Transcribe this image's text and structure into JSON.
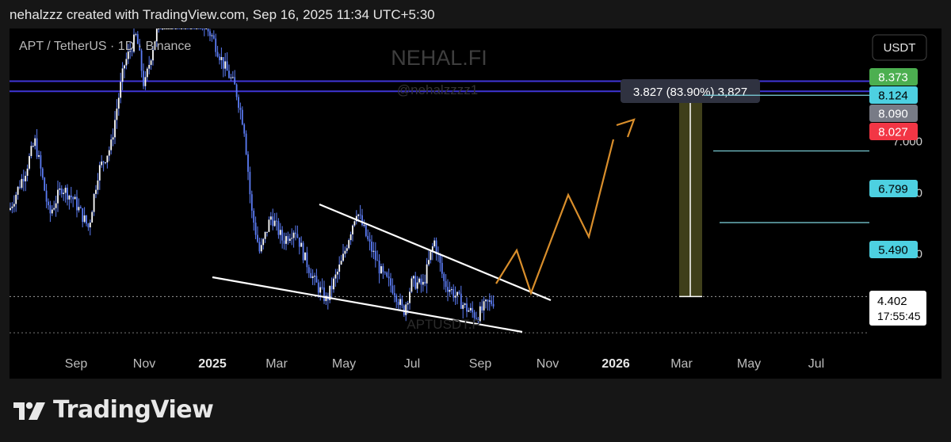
{
  "header": {
    "text": "nehalzzz created with TradingView.com, Sep 16, 2025 11:34 UTC+5:30"
  },
  "footer": {
    "brand": "TradingView"
  },
  "chart_data": {
    "type": "candlestick",
    "title": "APT / TetherUS · 1D · Binance",
    "watermark_name": "NEHAL.FI",
    "watermark_handle": "@nehalzzzz1",
    "watermark_symbol": "APTUSDT.P",
    "currency": "USDT",
    "y_scale": "log",
    "ylim": [
      3.85,
      9.8
    ],
    "x_ticks": [
      "Sep",
      "Nov",
      "2025",
      "Mar",
      "May",
      "Jul",
      "Sep",
      "Nov",
      "2026",
      "Mar",
      "May",
      "Jul"
    ],
    "y_ticks": [
      5.0,
      6.0,
      7.0
    ],
    "y_tick_labels": [
      "5.000",
      "6.000",
      "7.000"
    ],
    "horizontal_levels": [
      8.373,
      8.124
    ],
    "price_tags": [
      {
        "label": "8.373",
        "value": 8.373,
        "color": "#4caf50",
        "text_color": "#ffffff"
      },
      {
        "label": "8.124",
        "value": 8.124,
        "color": "#4dd0e1",
        "text_color": "#000000"
      },
      {
        "label": "8.090",
        "value": 8.09,
        "color": "#787b86",
        "text_color": "#ffffff"
      },
      {
        "label": "8.027",
        "value": 8.027,
        "color": "#f23645",
        "text_color": "#ffffff"
      },
      {
        "label": "6.799",
        "value": 6.799,
        "color": "#4dd0e1",
        "text_color": "#000000"
      },
      {
        "label": "5.490",
        "value": 5.49,
        "color": "#4dd0e1",
        "text_color": "#000000"
      }
    ],
    "current_price": {
      "label": "4.402",
      "countdown": "17:55:45",
      "value": 4.402
    },
    "lower_dotted_level": 3.95,
    "target_lines": [
      8.03,
      6.799,
      5.49
    ],
    "measure": {
      "label": "3.827 (83.90%) 3,827",
      "from": 4.402,
      "to": 8.09
    },
    "wedge": {
      "upper": [
        [
          "Apr",
          6.45
        ],
        [
          "Oct",
          4.4
        ]
      ],
      "lower": [
        [
          "Jan",
          4.85
        ],
        [
          "Oct",
          3.95
        ]
      ]
    },
    "projection_path": [
      4.6,
      5.5,
      4.6,
      6.7,
      5.7,
      8.0
    ],
    "colors": {
      "candle": "#5b7cf5",
      "candle_alt": "#ffffff",
      "level_line": "#3f35d6",
      "projection": "#d98e2b",
      "wedge": "#ffffff",
      "measure_fill": "#4a4a1e"
    }
  }
}
